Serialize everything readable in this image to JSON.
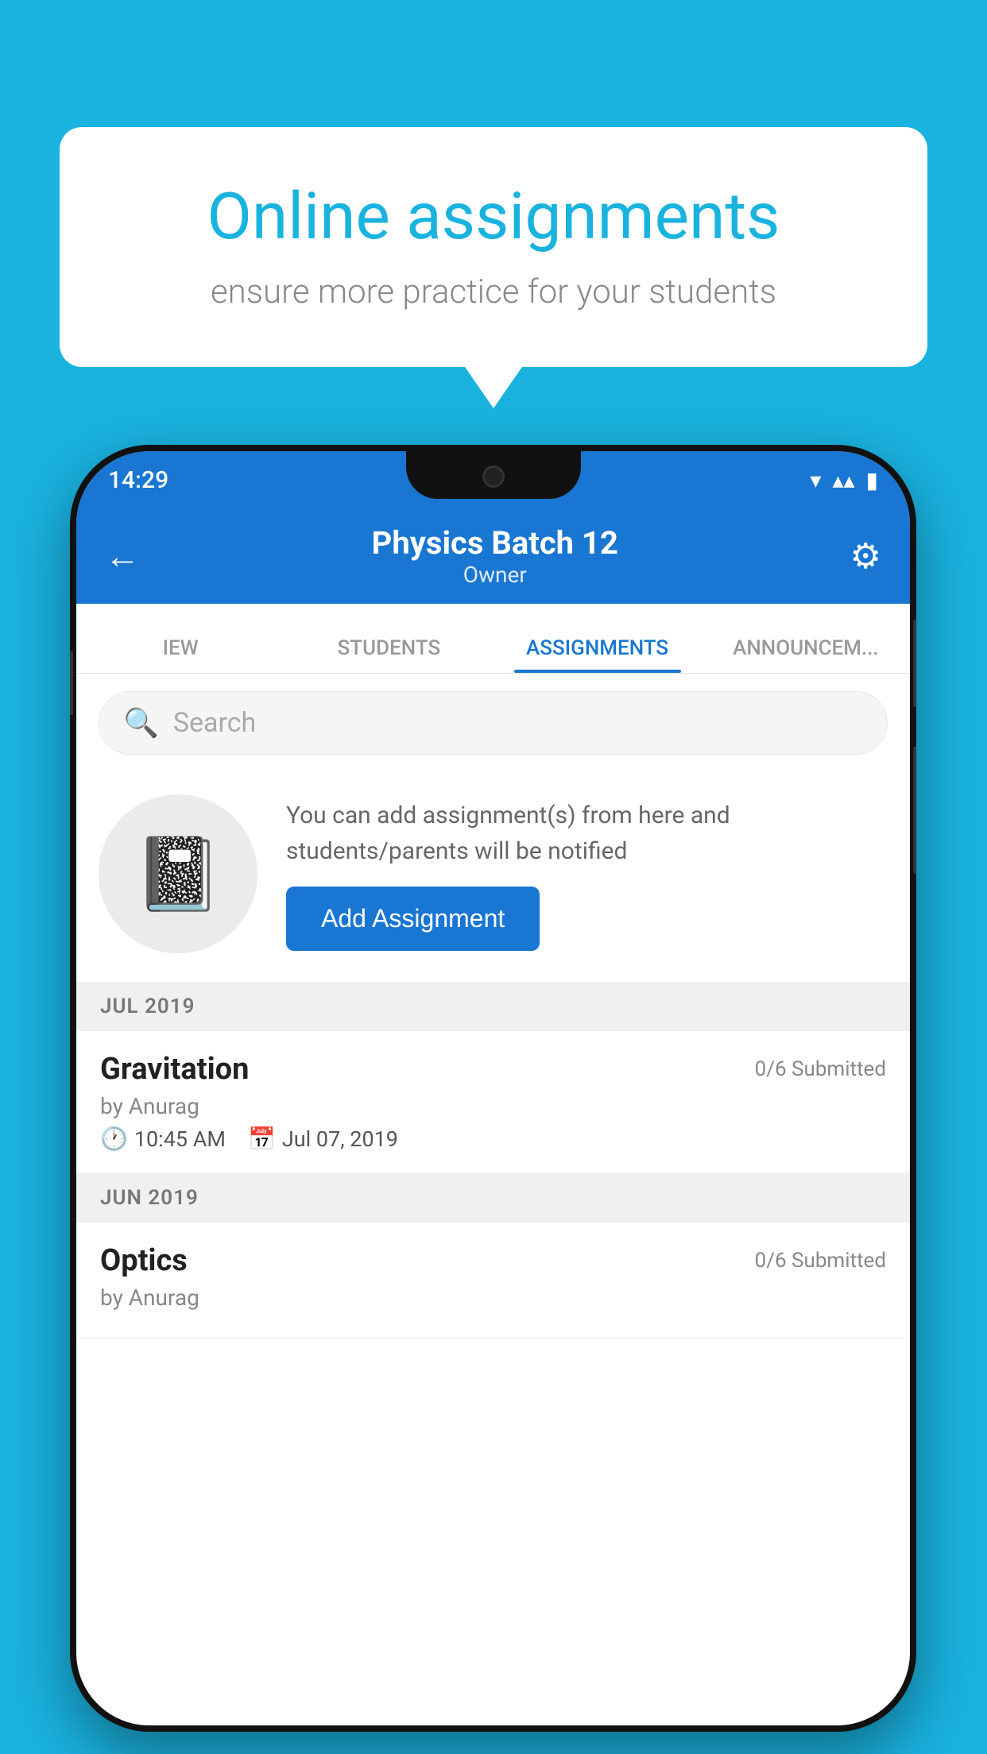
{
  "background_color": "#1ab3e0",
  "speech_bubble": {
    "title": "Online assignments",
    "subtitle": "ensure more practice for your students"
  },
  "status_bar": {
    "time": "14:29",
    "wifi_icon": "▾",
    "signal_icon": "▴",
    "battery_icon": "▮"
  },
  "header": {
    "title": "Physics Batch 12",
    "subtitle": "Owner",
    "back_icon": "←",
    "settings_icon": "⚙"
  },
  "tabs": [
    {
      "label": "IEW",
      "active": false
    },
    {
      "label": "STUDENTS",
      "active": false
    },
    {
      "label": "ASSIGNMENTS",
      "active": true
    },
    {
      "label": "ANNOUNCEM...",
      "active": false
    }
  ],
  "search": {
    "placeholder": "Search"
  },
  "add_assignment": {
    "description": "You can add assignment(s) from here and students/parents will be notified",
    "button_label": "Add Assignment"
  },
  "sections": [
    {
      "month": "JUL 2019",
      "assignments": [
        {
          "name": "Gravitation",
          "submitted": "0/6 Submitted",
          "author": "by Anurag",
          "time": "10:45 AM",
          "date": "Jul 07, 2019"
        }
      ]
    },
    {
      "month": "JUN 2019",
      "assignments": [
        {
          "name": "Optics",
          "submitted": "0/6 Submitted",
          "author": "by Anurag",
          "time": "",
          "date": ""
        }
      ]
    }
  ]
}
